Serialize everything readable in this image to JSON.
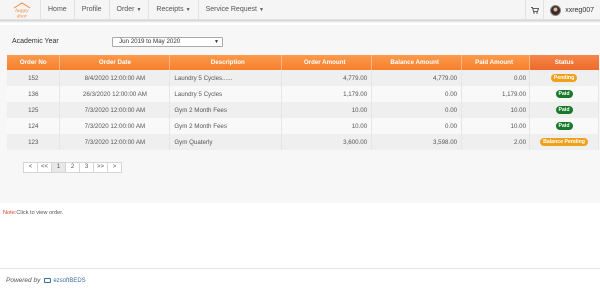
{
  "brand": {
    "name": "happy door",
    "line1": "happy",
    "line2": "door",
    "color": "#f08a3c"
  },
  "nav": [
    {
      "label": "Home",
      "dropdown": false
    },
    {
      "label": "Profile",
      "dropdown": false
    },
    {
      "label": "Order",
      "dropdown": true
    },
    {
      "label": "Receipts",
      "dropdown": true
    },
    {
      "label": "Service Request",
      "dropdown": true
    }
  ],
  "user": {
    "name": "xxreg007",
    "cart_icon": "cart-icon"
  },
  "filter": {
    "label": "Academic Year",
    "selected": "Jun 2019 to May 2020"
  },
  "table": {
    "headers": [
      "Order No",
      "Order Date",
      "Description",
      "Order Amount",
      "Balance Amount",
      "Paid Amount",
      "Status"
    ],
    "rows": [
      {
        "no": "152",
        "date": "8/4/2020 12:00:00 AM",
        "desc": "Laundry 5 Cycles......",
        "amount": "4,779.00",
        "balance": "4,779.00",
        "paid": "0.00",
        "status": "Pending"
      },
      {
        "no": "136",
        "date": "26/3/2020 12:00:00 AM",
        "desc": "Laundry 5 Cycles",
        "amount": "1,179.00",
        "balance": "0.00",
        "paid": "1,179.00",
        "status": "Paid"
      },
      {
        "no": "125",
        "date": "7/3/2020 12:00:00 AM",
        "desc": "Gym 2 Month Fees",
        "amount": "10.00",
        "balance": "0.00",
        "paid": "10.00",
        "status": "Paid"
      },
      {
        "no": "124",
        "date": "7/3/2020 12:00:00 AM",
        "desc": "Gym 2 Month Fees",
        "amount": "10.00",
        "balance": "0.00",
        "paid": "10.00",
        "status": "Paid"
      },
      {
        "no": "123",
        "date": "7/3/2020 12:00:00 AM",
        "desc": "Gym Quaterly",
        "amount": "3,600.00",
        "balance": "3,598.00",
        "paid": "2.00",
        "status": "Balance Pending"
      }
    ]
  },
  "pagination": [
    "<",
    "<<",
    "1",
    "2",
    "3",
    ">>",
    ">"
  ],
  "pagination_active": "1",
  "note": {
    "prefix": "Note:",
    "text": "Click to view order."
  },
  "footer": {
    "powered": "Powered by",
    "logo_text": "ezsoftBEDS"
  },
  "colors": {
    "header_orange": "#f57f2c",
    "pending": "#f0a11c",
    "paid": "#177a2a"
  }
}
